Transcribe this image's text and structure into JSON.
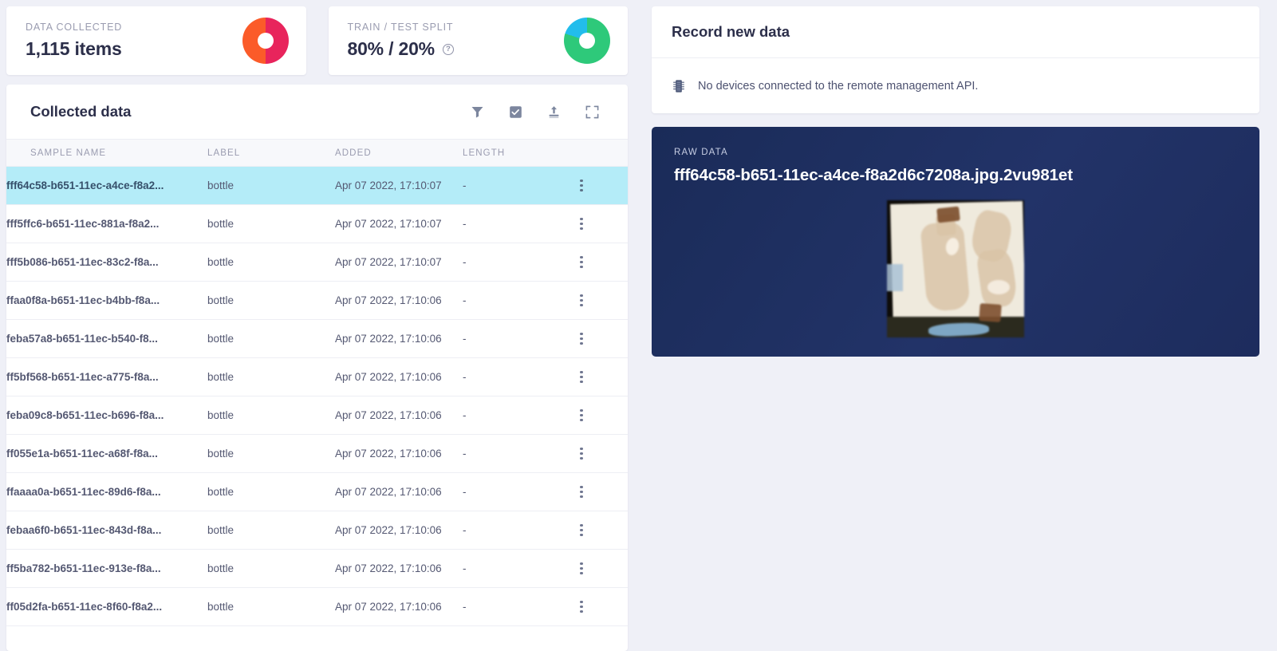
{
  "stats": [
    {
      "label": "DATA COLLECTED",
      "value": "1,115 items",
      "donut": "data-collected-donut",
      "colors": [
        "#fb5b29",
        "#e8245c"
      ]
    },
    {
      "label": "TRAIN / TEST SPLIT",
      "value": "80% / 20%",
      "help": "?",
      "donut": "train-test-split-donut",
      "colors": [
        "#2ec97a",
        "#22bdec"
      ]
    }
  ],
  "collected": {
    "title": "Collected data",
    "tools": [
      {
        "name": "filter-icon",
        "label": "Filter"
      },
      {
        "name": "select-multiple-icon",
        "label": "Select multiple"
      },
      {
        "name": "upload-icon",
        "label": "Upload data"
      },
      {
        "name": "expand-icon",
        "label": "Expand"
      }
    ],
    "columns": [
      "SAMPLE NAME",
      "LABEL",
      "ADDED",
      "LENGTH"
    ],
    "rows": [
      {
        "name": "fff64c58-b651-11ec-a4ce-f8a2...",
        "label": "bottle",
        "added": "Apr 07 2022, 17:10:07",
        "length": "-",
        "selected": true
      },
      {
        "name": "fff5ffc6-b651-11ec-881a-f8a2...",
        "label": "bottle",
        "added": "Apr 07 2022, 17:10:07",
        "length": "-",
        "selected": false
      },
      {
        "name": "fff5b086-b651-11ec-83c2-f8a...",
        "label": "bottle",
        "added": "Apr 07 2022, 17:10:07",
        "length": "-",
        "selected": false
      },
      {
        "name": "ffaa0f8a-b651-11ec-b4bb-f8a...",
        "label": "bottle",
        "added": "Apr 07 2022, 17:10:06",
        "length": "-",
        "selected": false
      },
      {
        "name": "feba57a8-b651-11ec-b540-f8...",
        "label": "bottle",
        "added": "Apr 07 2022, 17:10:06",
        "length": "-",
        "selected": false
      },
      {
        "name": "ff5bf568-b651-11ec-a775-f8a...",
        "label": "bottle",
        "added": "Apr 07 2022, 17:10:06",
        "length": "-",
        "selected": false
      },
      {
        "name": "feba09c8-b651-11ec-b696-f8a...",
        "label": "bottle",
        "added": "Apr 07 2022, 17:10:06",
        "length": "-",
        "selected": false
      },
      {
        "name": "ff055e1a-b651-11ec-a68f-f8a...",
        "label": "bottle",
        "added": "Apr 07 2022, 17:10:06",
        "length": "-",
        "selected": false
      },
      {
        "name": "ffaaaa0a-b651-11ec-89d6-f8a...",
        "label": "bottle",
        "added": "Apr 07 2022, 17:10:06",
        "length": "-",
        "selected": false
      },
      {
        "name": "febaa6f0-b651-11ec-843d-f8a...",
        "label": "bottle",
        "added": "Apr 07 2022, 17:10:06",
        "length": "-",
        "selected": false
      },
      {
        "name": "ff5ba782-b651-11ec-913e-f8a...",
        "label": "bottle",
        "added": "Apr 07 2022, 17:10:06",
        "length": "-",
        "selected": false
      },
      {
        "name": "ff05d2fa-b651-11ec-8f60-f8a2...",
        "label": "bottle",
        "added": "Apr 07 2022, 17:10:06",
        "length": "-",
        "selected": false
      }
    ]
  },
  "record": {
    "title": "Record new data",
    "device_icon": "microchip-icon",
    "message": "No devices connected to the remote management API."
  },
  "raw": {
    "label": "RAW DATA",
    "filename": "fff64c58-b651-11ec-a4ce-f8a2d6c7208a.jpg.2vu981et",
    "preview_alt": "blurred photo of plastic bottles on white surface",
    "panel_color": "#1e2e60"
  }
}
